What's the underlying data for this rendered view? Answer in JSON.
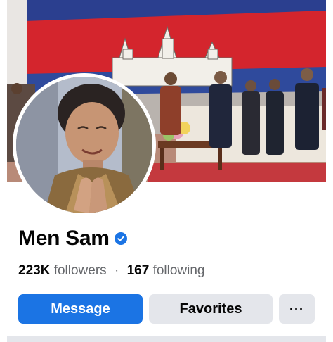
{
  "profile": {
    "name": "Men Sam",
    "verified": true,
    "followers_count": "223K",
    "followers_label": "followers",
    "following_count": "167",
    "following_label": "following",
    "separator": "·"
  },
  "actions": {
    "message_label": "Message",
    "favorites_label": "Favorites",
    "more_label": "···"
  },
  "colors": {
    "primary": "#1b74e4",
    "secondary_button": "#e4e6eb",
    "text_primary": "#050505",
    "text_secondary": "#65676b"
  },
  "icons": {
    "verified": "verified-badge-icon",
    "more": "more-options-icon"
  }
}
